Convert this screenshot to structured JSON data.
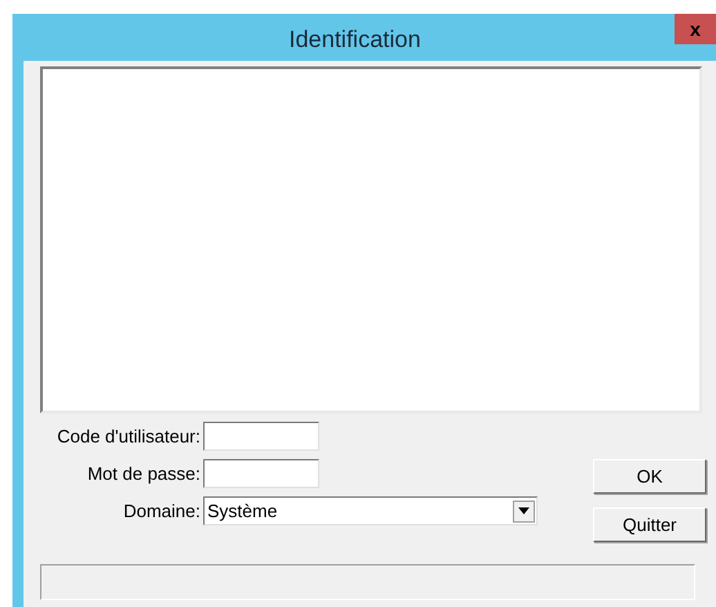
{
  "window": {
    "title": "Identification",
    "close": "x"
  },
  "fields": [
    {
      "kind": "text",
      "label": "Code d'utilisateur:"
    },
    {
      "kind": "text",
      "label": "Mot de passe:"
    },
    {
      "kind": "select",
      "label": "Domaine:",
      "value": "Système"
    }
  ],
  "buttons": [
    "OK",
    "Quitter"
  ]
}
